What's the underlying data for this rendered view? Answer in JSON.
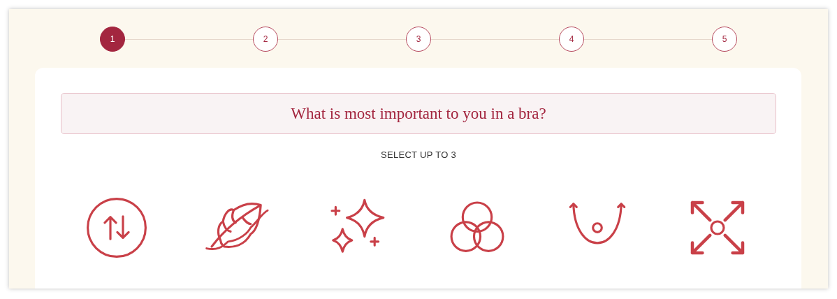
{
  "steps": [
    {
      "label": "1",
      "selected": true
    },
    {
      "label": "2",
      "selected": false
    },
    {
      "label": "3",
      "selected": false
    },
    {
      "label": "4",
      "selected": false
    },
    {
      "label": "5",
      "selected": false
    }
  ],
  "question": "What is most important to you in a bra?",
  "instruction": "SELECT UP TO 3",
  "options": [
    {
      "kind": "updown"
    },
    {
      "kind": "feather"
    },
    {
      "kind": "sparkles"
    },
    {
      "kind": "circles"
    },
    {
      "kind": "curve"
    },
    {
      "kind": "expand"
    }
  ]
}
